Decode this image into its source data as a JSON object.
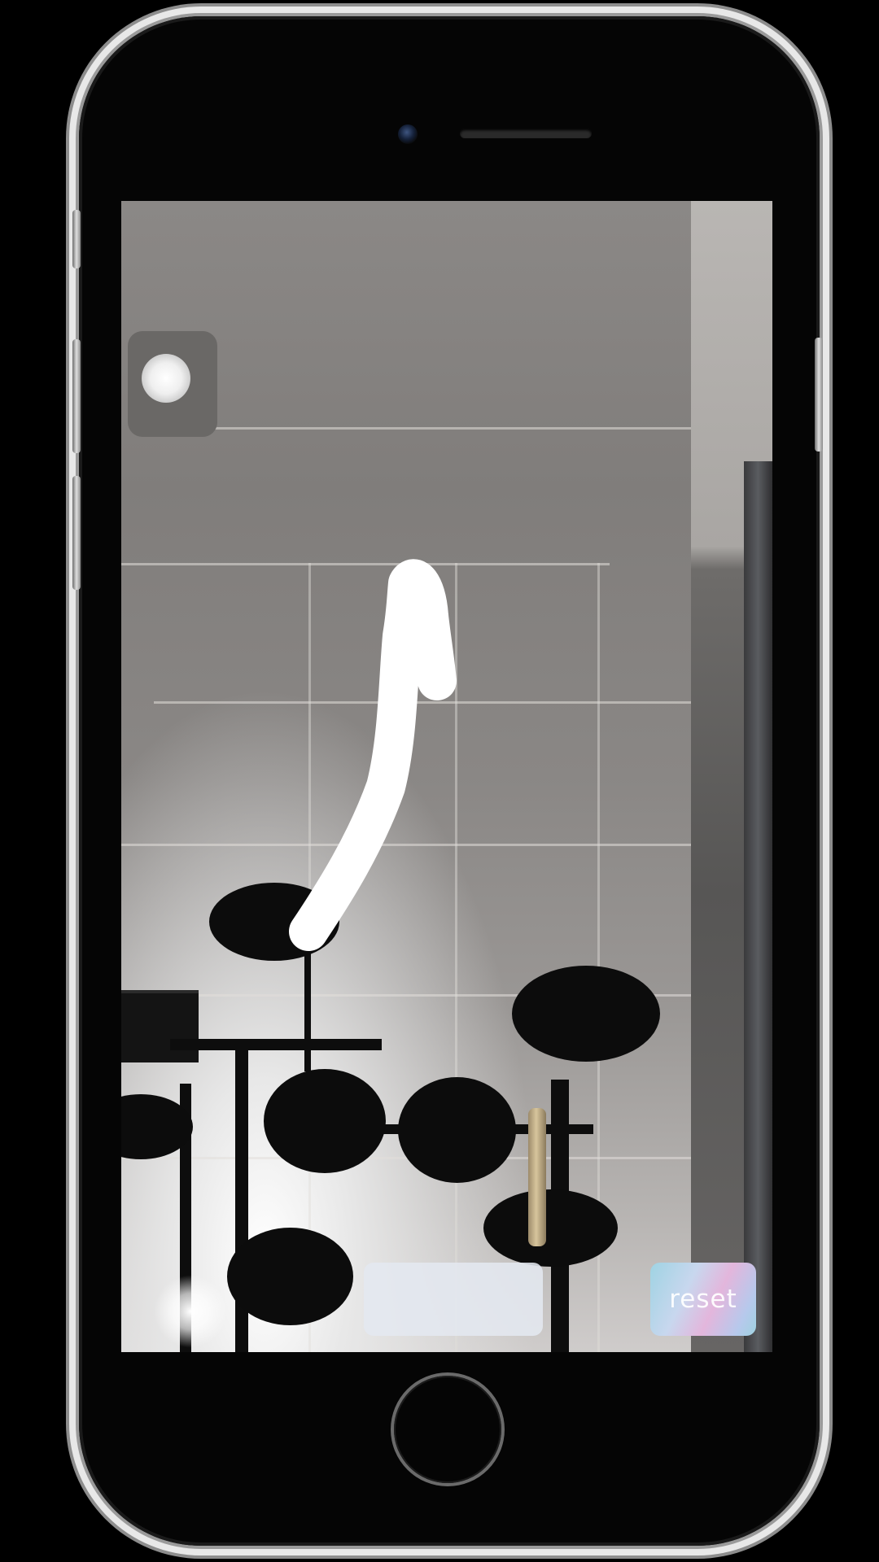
{
  "device": {
    "frame_color": "#e8e8e8",
    "screen_bezel_color": "#050505"
  },
  "ar_view": {
    "stroke_color": "#ffffff"
  },
  "controls": {
    "blank_button_label": "",
    "reset_label": "reset",
    "reset_gradient": [
      "#9fd3e3",
      "#c8d7ee",
      "#e3b6dc",
      "#b6c9ec"
    ]
  },
  "icons": {
    "front_camera": "front-camera-icon",
    "speaker": "earpiece-speaker-icon",
    "home": "home-button-icon"
  }
}
